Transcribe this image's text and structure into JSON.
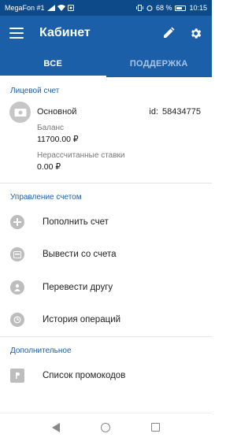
{
  "status_bar": {
    "carrier": "MegaFon #1",
    "battery": "68 %",
    "time": "10:15"
  },
  "header": {
    "title": "Кабинет"
  },
  "tabs": [
    {
      "label": "ВСЕ",
      "active": true
    },
    {
      "label": "ПОДДЕРЖКА",
      "active": false
    }
  ],
  "account_section": {
    "title": "Лицевой счет",
    "account_name": "Основной",
    "id_label": "id:",
    "id_value": "58434775",
    "balance_label": "Баланс",
    "balance_value": "11700.00 ₽",
    "unsettled_label": "Нерассчитанные ставки",
    "unsettled_value": "0.00 ₽"
  },
  "manage_section": {
    "title": "Управление счетом",
    "items": [
      {
        "label": "Пополнить счет",
        "icon": "plus-icon"
      },
      {
        "label": "Вывести со счета",
        "icon": "withdraw-icon"
      },
      {
        "label": "Перевести другу",
        "icon": "person-icon"
      },
      {
        "label": "История операций",
        "icon": "history-icon"
      }
    ]
  },
  "extra_section": {
    "title": "Дополнительное",
    "items": [
      {
        "label": "Список промокодов",
        "icon": "promo-icon"
      }
    ]
  },
  "colors": {
    "status_bar": "#0d4a8a",
    "app_bar": "#1a5fa8",
    "section_title": "#1a5fa8"
  }
}
